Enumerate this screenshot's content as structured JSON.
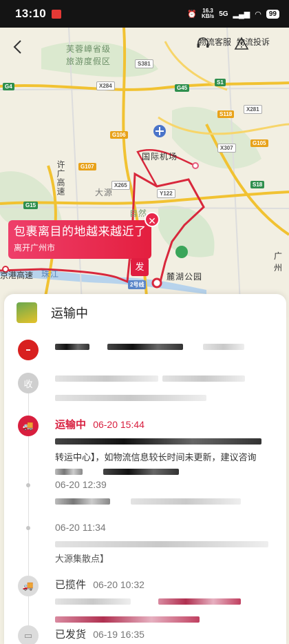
{
  "status_bar": {
    "time": "13:10",
    "net_speed_value": "16.3",
    "net_speed_unit": "KB/s",
    "signal": "5G",
    "battery": "99"
  },
  "header": {
    "back_icon": "chevron-left-icon",
    "service_label": "物流客服",
    "complaint_label": "物流投诉"
  },
  "map": {
    "labels": [
      "芙蓉嶂省级",
      "旅游度假区",
      "国际机场",
      "大源",
      "自然",
      "麓湖公园",
      "广州",
      "珠江",
      "许广高速"
    ],
    "road_badges": [
      "G4",
      "G45",
      "S1",
      "X284",
      "G106",
      "G107",
      "S118",
      "X281",
      "X265",
      "Y122",
      "X307",
      "G105",
      "S18",
      "G15",
      "S381",
      "2号线",
      "京港高速"
    ]
  },
  "bubble": {
    "title": "包裹离目的地越来越近了",
    "subtitle": "离开广州市",
    "close_icon": "close-icon"
  },
  "send_marker": "发",
  "sheet": {
    "status": "运输中",
    "receive_badge": "收",
    "timeline": [
      {
        "title": "运输中",
        "time": "06-20 15:44",
        "text": "转运中心】，如物流信息较长时间未更新，建议咨询"
      },
      {
        "time": "06-20 12:39"
      },
      {
        "time": "06-20 11:34",
        "text": "大源集散点】"
      },
      {
        "title": "已揽件",
        "time": "06-20 10:32"
      },
      {
        "title": "已发货",
        "time": "06-19 16:35"
      }
    ]
  },
  "colors": {
    "accent": "#d81e3e",
    "route": "#d8283c"
  }
}
